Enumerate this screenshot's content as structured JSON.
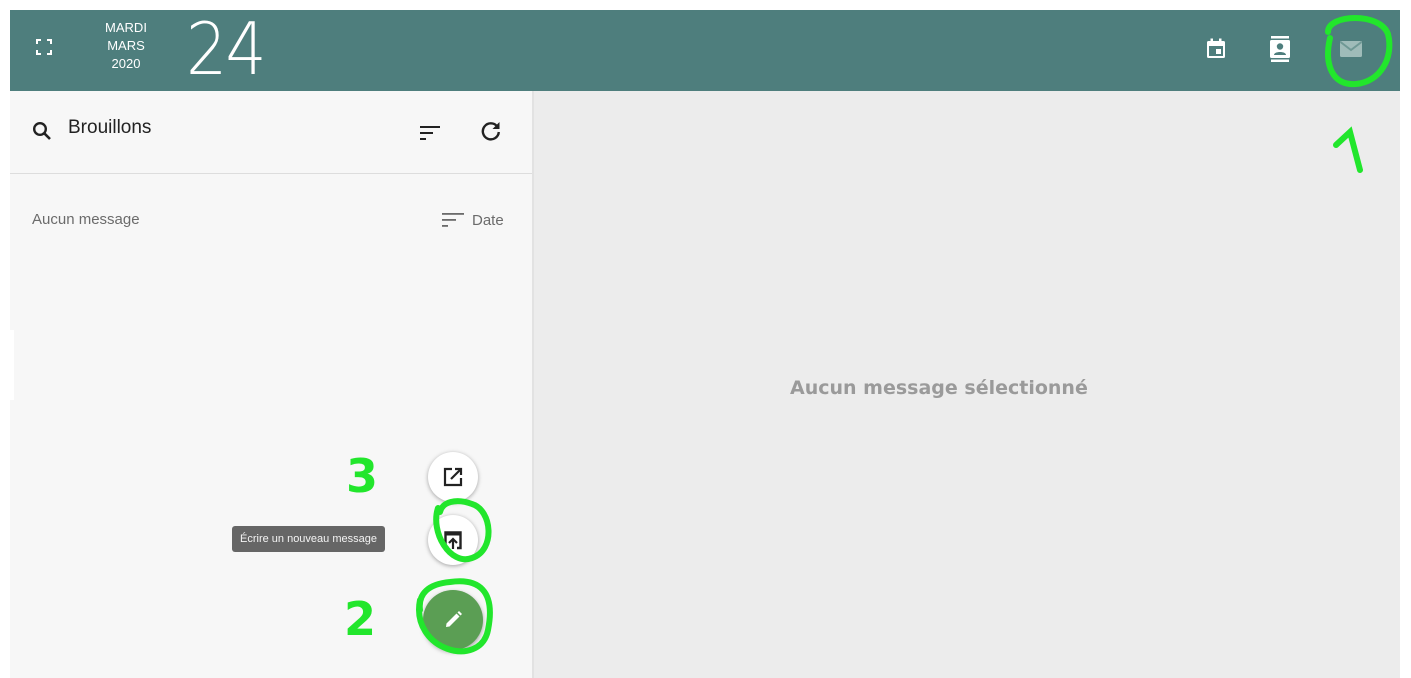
{
  "header": {
    "date": {
      "weekday": "MARDI",
      "month": "MARS",
      "year": "2020",
      "day": "24"
    },
    "icons": {
      "fullscreen": "fullscreen-icon",
      "calendar": "calendar-icon",
      "contacts": "contacts-icon",
      "mail": "mail-icon"
    },
    "bg_color": "#4e7e7d"
  },
  "mail_list": {
    "folder_title": "Brouillons",
    "status": "Aucun message",
    "sort_label": "Date",
    "icons": {
      "search": "search-icon",
      "sort": "sort-icon",
      "refresh": "refresh-icon"
    }
  },
  "compose": {
    "tooltip": "Écrire un nouveau message",
    "icons": {
      "external": "open-in-new-icon",
      "inline": "open-in-browser-icon",
      "main": "pencil-icon"
    },
    "main_color": "#5b9e54"
  },
  "reading_pane": {
    "empty_text": "Aucun message sélectionné"
  },
  "annotations": {
    "markers": [
      "1",
      "2",
      "3"
    ],
    "color": "#22e62c"
  }
}
